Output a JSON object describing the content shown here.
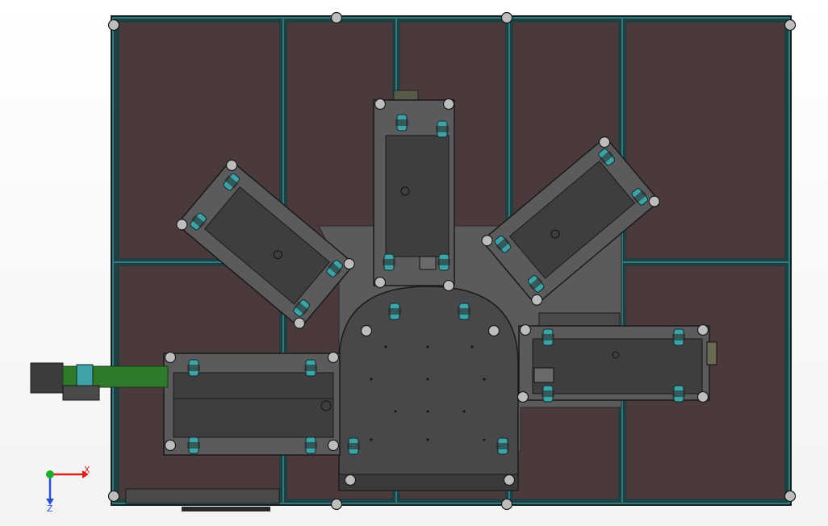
{
  "viewport": {
    "view_name": "",
    "background": "#ffffff"
  },
  "colors": {
    "panel_fill": "#4a3a3c",
    "frame_teal": "#2f6b6b",
    "frame_dark": "#1f3f42",
    "steel": "#5b5b5d",
    "steel_dark": "#48484a",
    "plate": "#3e3e40",
    "roller": "#3fa2a6",
    "belt": "#2f7a2a",
    "accent_blue": "#2b4fd6"
  },
  "triad": {
    "x_label": "X",
    "z_label": "Z",
    "x_color": "#d9221b",
    "y_color": "#1fae2a",
    "z_color": "#2b4fd6"
  },
  "icons": {
    "triad": "reference-triad-icon"
  }
}
